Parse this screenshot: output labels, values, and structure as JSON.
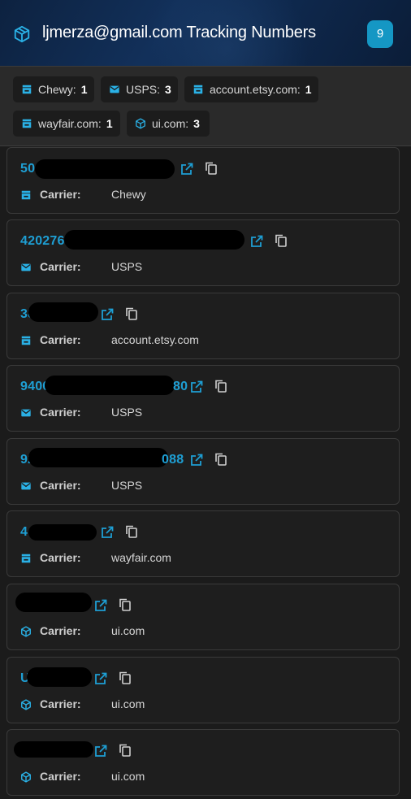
{
  "header": {
    "title": "ljmerza@gmail.com Tracking Numbers",
    "count": "9",
    "icon": "package-icon"
  },
  "summary": [
    {
      "label": "Chewy:",
      "count": "1",
      "icon": "store-icon"
    },
    {
      "label": "USPS:",
      "count": "3",
      "icon": "mail-icon"
    },
    {
      "label": "account.etsy.com:",
      "count": "1",
      "icon": "store-icon"
    },
    {
      "label": "wayfair.com:",
      "count": "1",
      "icon": "store-icon"
    },
    {
      "label": "ui.com:",
      "count": "3",
      "icon": "package-icon"
    }
  ],
  "carrier_label": "Carrier:",
  "shipments": [
    {
      "tracking_visible": "50",
      "carrier": "Chewy",
      "icon": "store-icon"
    },
    {
      "tracking_visible": "420276",
      "carrier": "USPS",
      "icon": "mail-icon"
    },
    {
      "tracking_visible": "38",
      "carrier": "account.etsy.com",
      "icon": "store-icon"
    },
    {
      "tracking_visible": "9400",
      "tracking_suffix": "80",
      "carrier": "USPS",
      "icon": "mail-icon"
    },
    {
      "tracking_visible": "92",
      "tracking_suffix": "088",
      "carrier": "USPS",
      "icon": "mail-icon"
    },
    {
      "tracking_visible": "4",
      "carrier": "wayfair.com",
      "icon": "store-icon"
    },
    {
      "tracking_visible": "",
      "carrier": "ui.com",
      "icon": "package-icon"
    },
    {
      "tracking_visible": "U",
      "carrier": "ui.com",
      "icon": "package-icon"
    },
    {
      "tracking_visible": "",
      "carrier": "ui.com",
      "icon": "package-icon"
    }
  ],
  "colors": {
    "accent": "#1e9fd4",
    "badge": "#1597c4",
    "card_bg": "#1e1e1e",
    "page_bg": "#1b1b1b"
  }
}
